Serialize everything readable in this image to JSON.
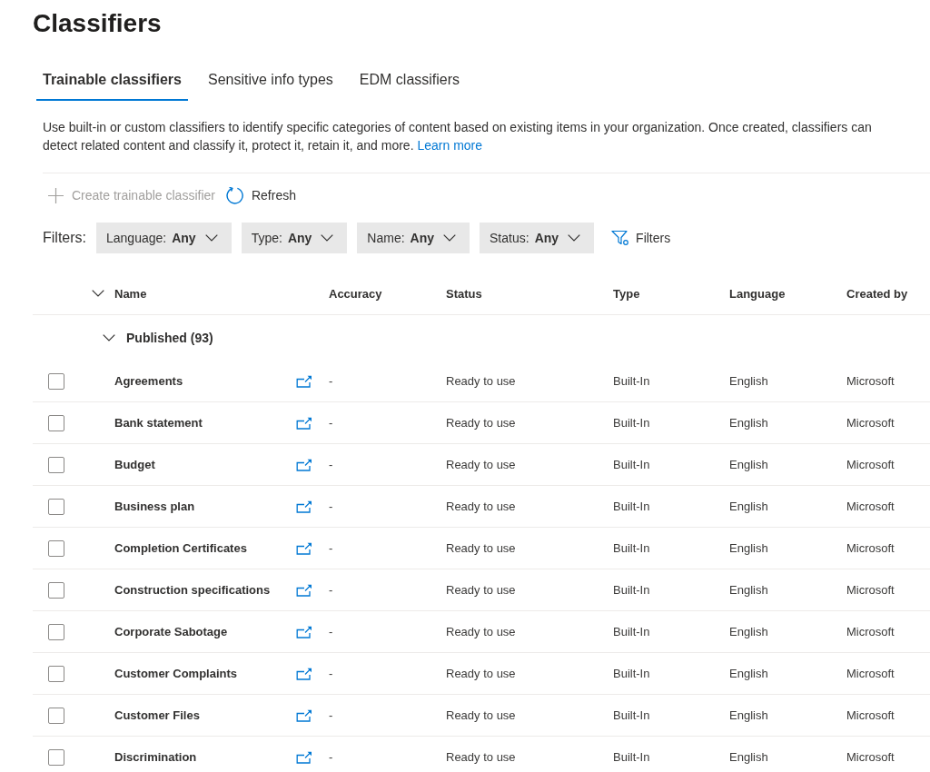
{
  "page": {
    "title": "Classifiers"
  },
  "tabs": [
    {
      "label": "Trainable classifiers",
      "selected": true
    },
    {
      "label": "Sensitive info types",
      "selected": false
    },
    {
      "label": "EDM classifiers",
      "selected": false
    }
  ],
  "description": {
    "text": "Use built-in or custom classifiers to identify specific categories of content based on existing items in your organization. Once created, classifiers can detect related content and classify it, protect it, retain it, and more.",
    "link": "Learn more"
  },
  "commands": [
    {
      "kind": "add",
      "label": "Create trainable classifier",
      "disabled": true
    },
    {
      "kind": "refresh",
      "label": "Refresh",
      "disabled": false
    }
  ],
  "filters": {
    "label": "Filters:",
    "pills": [
      {
        "name": "Language:",
        "value": "Any"
      },
      {
        "name": "Type:",
        "value": "Any"
      },
      {
        "name": "Name:",
        "value": "Any"
      },
      {
        "name": "Status:",
        "value": "Any"
      }
    ],
    "button": "Filters"
  },
  "table": {
    "columns": [
      "Name",
      "Accuracy",
      "Status",
      "Type",
      "Language",
      "Created by"
    ],
    "groups": [
      {
        "label": "Published (93)",
        "expanded": true,
        "rows": [
          {
            "name": "Agreements",
            "accuracy": "-",
            "status": "Ready to use",
            "type": "Built-In",
            "language": "English",
            "created_by": "Microsoft",
            "checked": false
          },
          {
            "name": "Bank statement",
            "accuracy": "-",
            "status": "Ready to use",
            "type": "Built-In",
            "language": "English",
            "created_by": "Microsoft",
            "checked": false
          },
          {
            "name": "Budget",
            "accuracy": "-",
            "status": "Ready to use",
            "type": "Built-In",
            "language": "English",
            "created_by": "Microsoft",
            "checked": false
          },
          {
            "name": "Business plan",
            "accuracy": "-",
            "status": "Ready to use",
            "type": "Built-In",
            "language": "English",
            "created_by": "Microsoft",
            "checked": false
          },
          {
            "name": "Completion Certificates",
            "accuracy": "-",
            "status": "Ready to use",
            "type": "Built-In",
            "language": "English",
            "created_by": "Microsoft",
            "checked": false
          },
          {
            "name": "Construction specifications",
            "accuracy": "-",
            "status": "Ready to use",
            "type": "Built-In",
            "language": "English",
            "created_by": "Microsoft",
            "checked": false
          },
          {
            "name": "Corporate Sabotage",
            "accuracy": "-",
            "status": "Ready to use",
            "type": "Built-In",
            "language": "English",
            "created_by": "Microsoft",
            "checked": false
          },
          {
            "name": "Customer Complaints",
            "accuracy": "-",
            "status": "Ready to use",
            "type": "Built-In",
            "language": "English",
            "created_by": "Microsoft",
            "checked": false
          },
          {
            "name": "Customer Files",
            "accuracy": "-",
            "status": "Ready to use",
            "type": "Built-In",
            "language": "English",
            "created_by": "Microsoft",
            "checked": false
          },
          {
            "name": "Discrimination",
            "accuracy": "-",
            "status": "Ready to use",
            "type": "Built-In",
            "language": "English",
            "created_by": "Microsoft",
            "checked": false
          }
        ]
      }
    ]
  }
}
